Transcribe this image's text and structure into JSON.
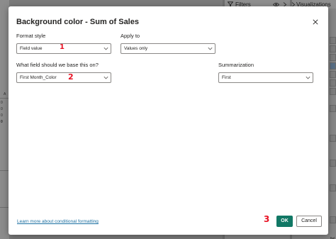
{
  "background": {
    "filters_pane_title": "Filters",
    "visualizations_pane_title": "Visualizations",
    "table_fragments": [
      "A",
      "0",
      "0",
      "0",
      "0"
    ],
    "viz_edge_label": "fiel"
  },
  "dialog": {
    "title": "Background color - Sum of Sales",
    "format_style": {
      "label": "Format style",
      "value": "Field value"
    },
    "apply_to": {
      "label": "Apply to",
      "value": "Values only"
    },
    "base_field": {
      "label": "What field should we base this on?",
      "value": "First Month_Color"
    },
    "summarization": {
      "label": "Summarization",
      "value": "First"
    },
    "learn_more_link": "Learn more about conditional formatting",
    "ok_label": "OK",
    "cancel_label": "Cancel"
  },
  "annotations": [
    "1",
    "2",
    "3"
  ],
  "colors": {
    "ok_button": "#117865",
    "link": "#1a6fa1",
    "annotation": "#e81123"
  }
}
